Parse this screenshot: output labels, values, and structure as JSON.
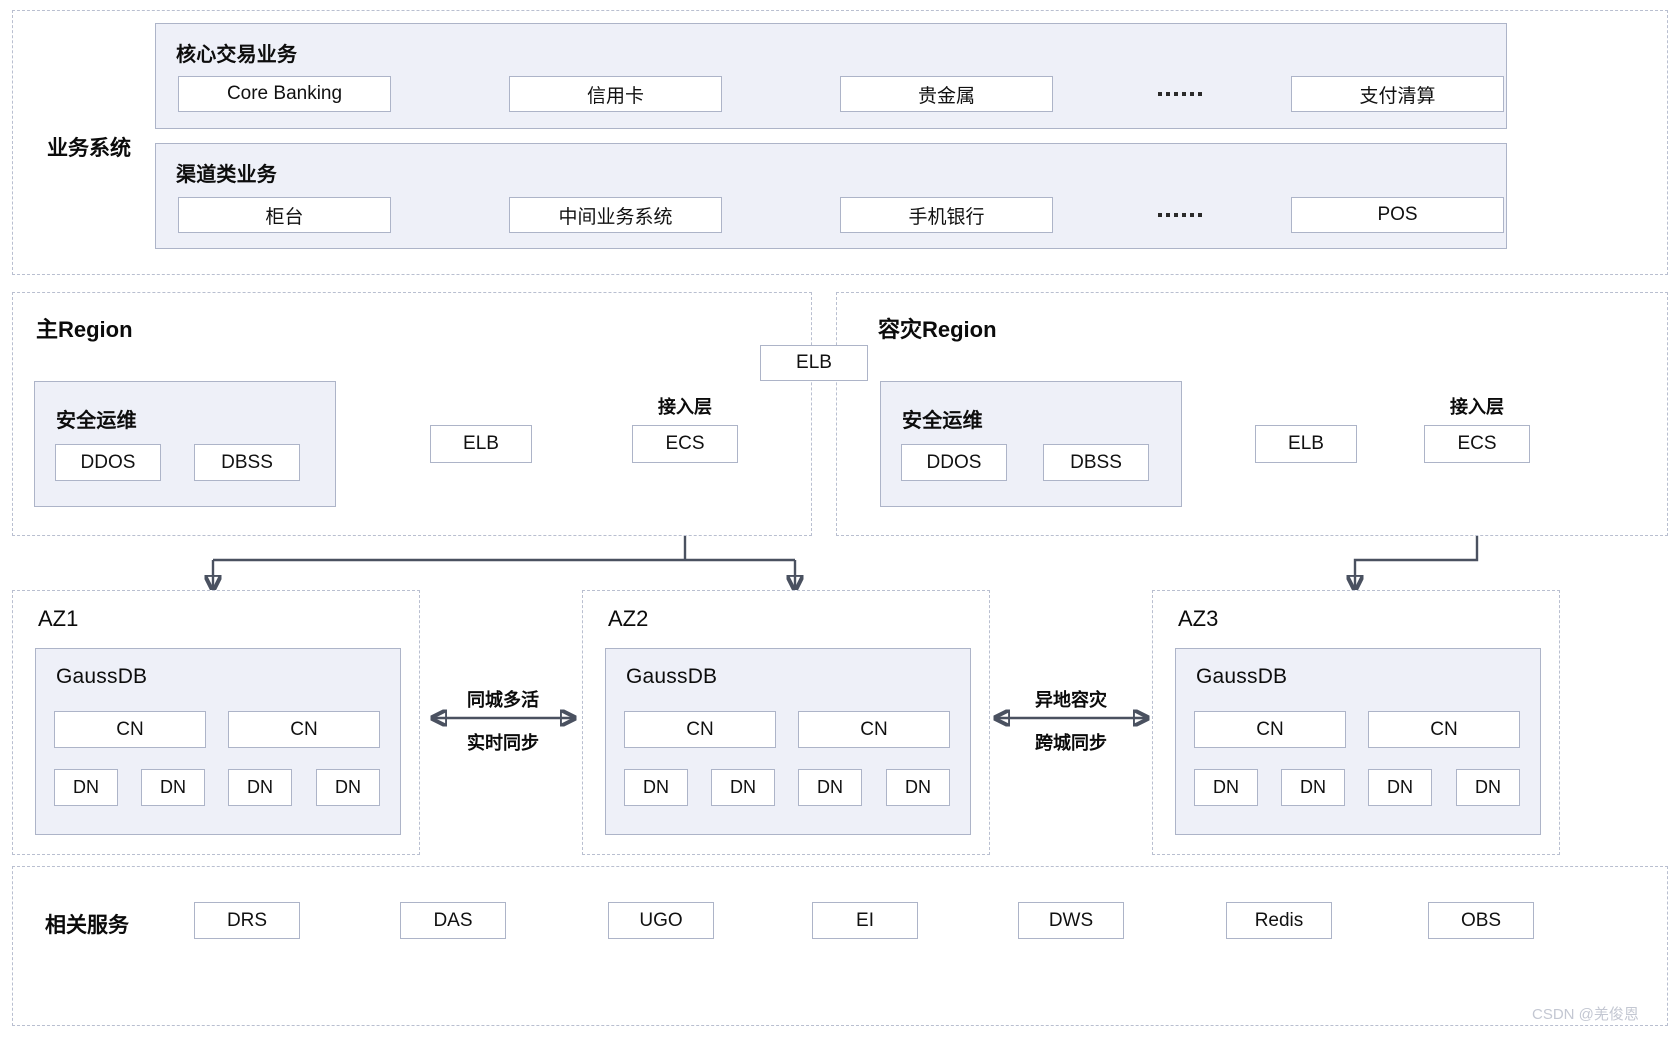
{
  "business": {
    "label": "业务系统",
    "groups": [
      {
        "title": "核心交易业务",
        "items": [
          "Core Banking",
          "信用卡",
          "贵金属",
          "支付清算"
        ],
        "ellipsis": "......"
      },
      {
        "title": "渠道类业务",
        "items": [
          "柜台",
          "中间业务系统",
          "手机银行",
          "POS"
        ],
        "ellipsis": "......"
      }
    ]
  },
  "global_elb": {
    "label": "ELB"
  },
  "regions": [
    {
      "title": "主Region",
      "security": {
        "title": "安全运维",
        "items": [
          "DDOS",
          "DBSS"
        ]
      },
      "elb": "ELB",
      "access_layer_label": "接入层",
      "ecs": "ECS"
    },
    {
      "title": "容灾Region",
      "security": {
        "title": "安全运维",
        "items": [
          "DDOS",
          "DBSS"
        ]
      },
      "elb": "ELB",
      "access_layer_label": "接入层",
      "ecs": "ECS"
    }
  ],
  "zones": [
    {
      "title": "AZ1",
      "db_title": "GaussDB",
      "cn_nodes": [
        "CN",
        "CN"
      ],
      "dn_nodes": [
        "DN",
        "DN",
        "DN",
        "DN"
      ]
    },
    {
      "title": "AZ2",
      "db_title": "GaussDB",
      "cn_nodes": [
        "CN",
        "CN"
      ],
      "dn_nodes": [
        "DN",
        "DN",
        "DN",
        "DN"
      ]
    },
    {
      "title": "AZ3",
      "db_title": "GaussDB",
      "cn_nodes": [
        "CN",
        "CN"
      ],
      "dn_nodes": [
        "DN",
        "DN",
        "DN",
        "DN"
      ]
    }
  ],
  "links": [
    {
      "top": "同城多活",
      "bottom": "实时同步"
    },
    {
      "top": "异地容灾",
      "bottom": "跨城同步"
    }
  ],
  "services": {
    "label": "相关服务",
    "items": [
      "DRS",
      "DAS",
      "UGO",
      "EI",
      "DWS",
      "Redis",
      "OBS"
    ]
  },
  "watermark": "CSDN @羌俊恩",
  "colors": {
    "panel_fill": "#eef0f8",
    "panel_border": "#adb4c8",
    "dash_border": "#b9bfd0",
    "wire": "#4a5160",
    "node_fill": "#ffffff",
    "text": "#111111",
    "watermark": "#c3c7d2"
  }
}
